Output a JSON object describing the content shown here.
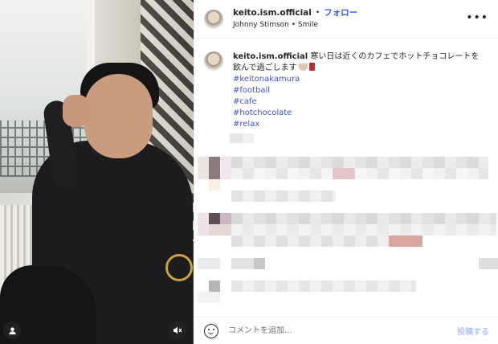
{
  "header": {
    "username": "keito.ism.official",
    "separator": "•",
    "follow_label": "フォロー",
    "subtitle": "Johnny Stimson • Smile",
    "more_icon": "more-horizontal-icon"
  },
  "caption": {
    "username": "keito.ism.official",
    "text": "寒い日は近くのカフェでホットチョコレートを飲んで過ごします",
    "hashtags": [
      "#keitonakamura",
      "#football",
      "#cafe",
      "#hotchocolate",
      "#relax"
    ]
  },
  "photo": {
    "profile_icon": "user-icon",
    "mute_icon": "speaker-muted-icon"
  },
  "footer": {
    "emoji_icon": "smile-icon",
    "comment_placeholder": "コメントを追加...",
    "post_label": "投稿する"
  },
  "colors": {
    "follow": "#3757f5",
    "hashtag": "#3f57c9",
    "post_disabled": "#b2c6f7"
  }
}
